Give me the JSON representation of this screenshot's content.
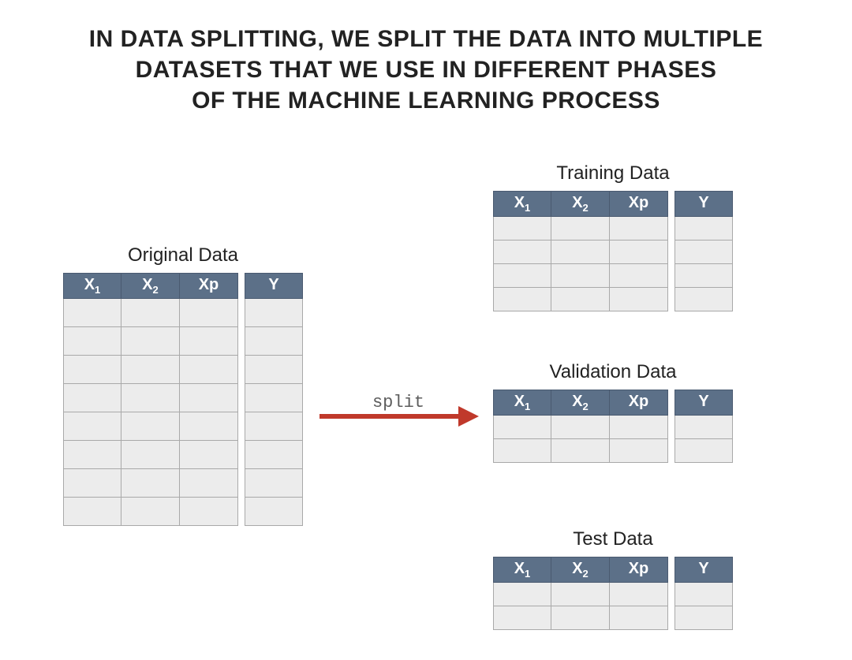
{
  "title_lines": [
    "IN DATA SPLITTING, WE SPLIT THE DATA INTO MULTIPLE",
    "DATASETS THAT WE USE IN DIFFERENT PHASES",
    "OF THE MACHINE LEARNING PROCESS"
  ],
  "arrow_label": "split",
  "arrow_color": "#c0392b",
  "header_bg": "#5c7088",
  "cell_bg": "#ececec",
  "columns_x": [
    "X1",
    "X2",
    "Xp"
  ],
  "column_y": "Y",
  "tables": {
    "original": {
      "label": "Original Data",
      "rows": 8
    },
    "training": {
      "label": "Training Data",
      "rows": 4
    },
    "validation": {
      "label": "Validation Data",
      "rows": 2
    },
    "test": {
      "label": "Test Data",
      "rows": 2
    }
  }
}
